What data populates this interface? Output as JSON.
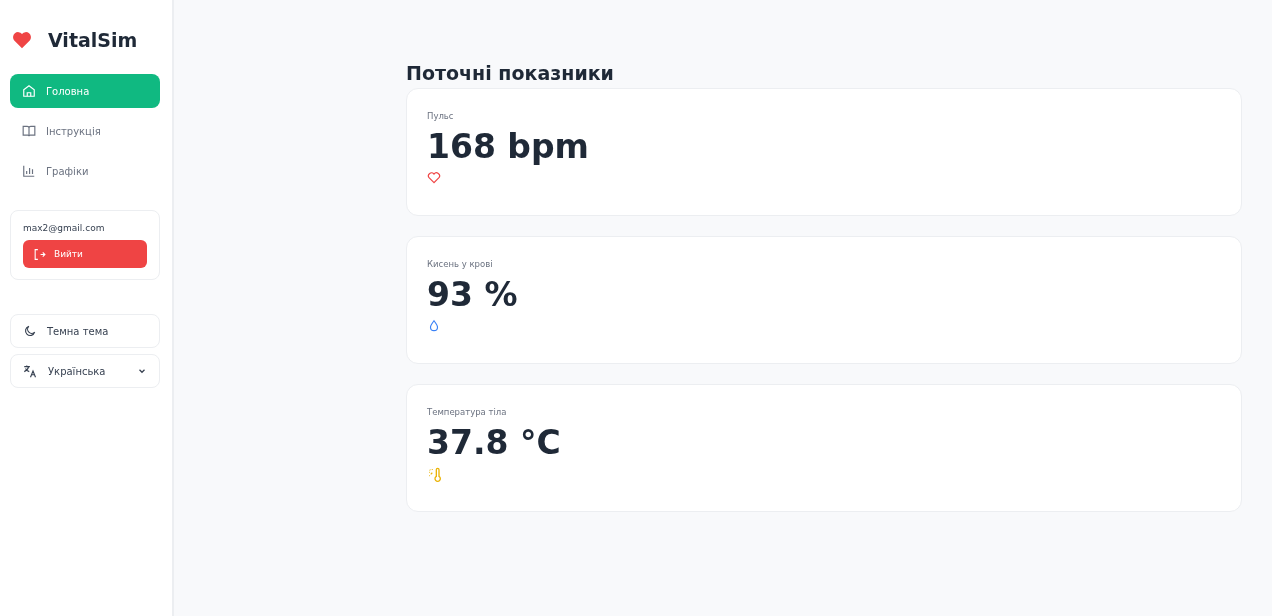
{
  "app": {
    "name": "VitalSim"
  },
  "nav": [
    {
      "label": "Головна",
      "kind": "home",
      "selected": true
    },
    {
      "label": "Інструкція",
      "kind": "book",
      "selected": false
    },
    {
      "label": "Графіки",
      "kind": "chart",
      "selected": false
    }
  ],
  "account": {
    "email": "max2@gmail.com",
    "logout": "Вийти"
  },
  "theme": {
    "label": "Темна тема"
  },
  "language": {
    "value": "Українська"
  },
  "page": {
    "title": "Поточні показники"
  },
  "metrics": [
    {
      "label": "Пульс",
      "value": "168 bpm",
      "kind": "heart"
    },
    {
      "label": "Кисень у крові",
      "value": "93 %",
      "kind": "drop"
    },
    {
      "label": "Температура тіла",
      "value": "37.8 °C",
      "kind": "thermo"
    }
  ]
}
